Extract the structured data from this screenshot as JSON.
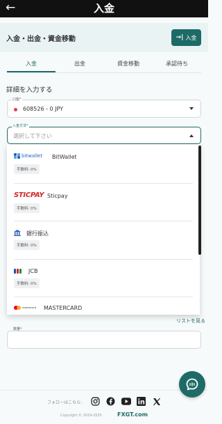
{
  "header": {
    "back_icon": "arrow-left-icon",
    "title": "入金"
  },
  "subheader": {
    "title": "入金・出金・資金移動",
    "action_label": "入金",
    "action_icon": "login-arrow-icon"
  },
  "tabs": [
    {
      "label": "入金",
      "active": true
    },
    {
      "label": "出金",
      "active": false
    },
    {
      "label": "資金移動",
      "active": false
    },
    {
      "label": "承認待ち",
      "active": false
    }
  ],
  "form": {
    "section_title": "詳細を入力する",
    "account": {
      "label": "口座*",
      "value": "608526 - 0 JPY"
    },
    "method": {
      "label": "入金方法*",
      "placeholder": "選択して下さい"
    },
    "amount": {
      "label": "数量*",
      "value": ""
    },
    "see_list": "リストを見る"
  },
  "payment_methods": [
    {
      "logo_text": "bitwallet",
      "name": "BitWallet",
      "fee": "手数料: 0%"
    },
    {
      "logo_text": "STICPAY",
      "name": "Sticpay",
      "fee": "手数料: 0%"
    },
    {
      "logo_text": "",
      "name": "銀行振込",
      "fee": "手数料: 0%"
    },
    {
      "logo_text": "",
      "name": "JCB",
      "fee": "手数料: 0%"
    },
    {
      "logo_text": "mastercard",
      "name": "MASTERCARD",
      "fee": ""
    }
  ],
  "footer": {
    "follow_label": "フォローはこちら:",
    "socials": [
      "instagram-icon",
      "facebook-icon",
      "youtube-icon",
      "linkedin-icon",
      "x-icon"
    ],
    "copyright": "Copyright © 2019-2025",
    "brand": "FXGT.com"
  },
  "colors": {
    "accent": "#1d6b66",
    "topbar": "#111111",
    "account_dot": "#e8384f"
  }
}
